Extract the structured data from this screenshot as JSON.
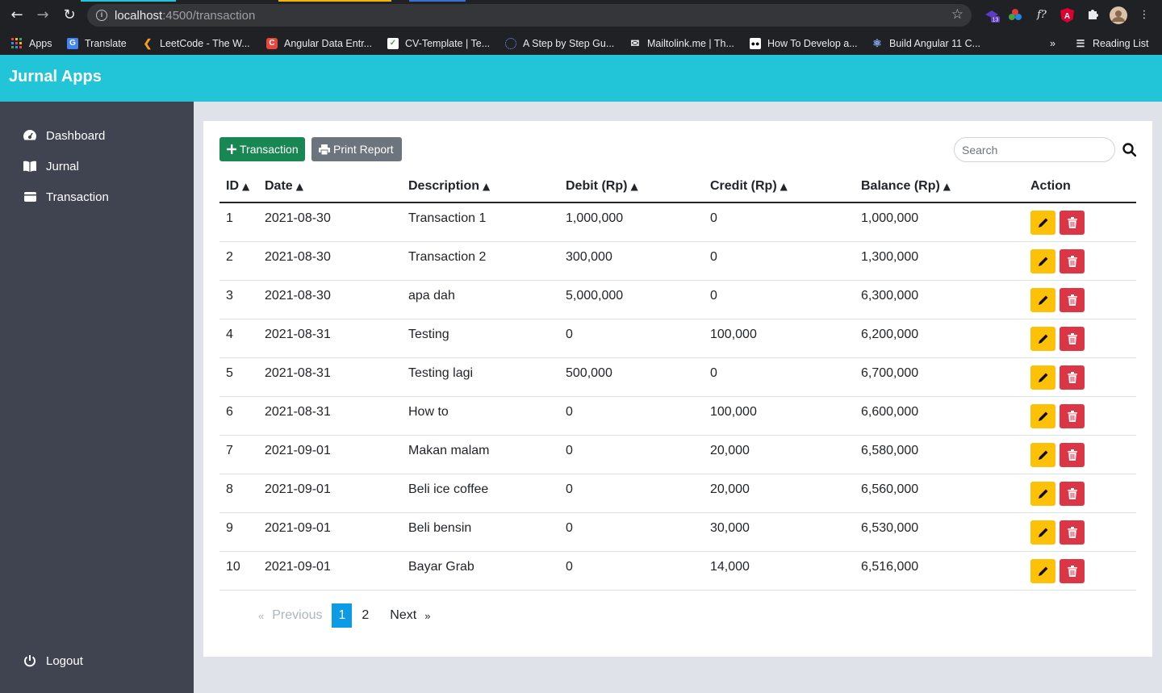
{
  "browser": {
    "url_host": "localhost",
    "url_path": ":4500/transaction",
    "extension_badge": "13",
    "bookmarks": [
      {
        "label": "Apps",
        "icon": "apps-grid-icon",
        "color": "#e8453c"
      },
      {
        "label": "Translate",
        "icon": "google-translate-icon",
        "color": "#4285f4"
      },
      {
        "label": "LeetCode - The W...",
        "icon": "leetcode-icon",
        "color": "#f89f1b"
      },
      {
        "label": "Angular Data Entr...",
        "icon": "codecademy-icon",
        "color": "#e8453c"
      },
      {
        "label": "CV-Template | Te...",
        "icon": "overleaf-icon",
        "color": "#47a141"
      },
      {
        "label": "A Step by Step Gu...",
        "icon": "article-icon",
        "color": "#2a5db0"
      },
      {
        "label": "Mailtolink.me | Th...",
        "icon": "mail-icon",
        "color": "#e8eaed"
      },
      {
        "label": "How To Develop a...",
        "icon": "medium-icon",
        "color": "#ffffff"
      },
      {
        "label": "Build Angular 11 C...",
        "icon": "react-icon",
        "color": "#61dafb"
      }
    ],
    "overflow_label": "»",
    "reading_list_label": "Reading List"
  },
  "app": {
    "title": "Jurnal Apps",
    "header_color": "#22c5d8"
  },
  "sidebar": {
    "items": [
      {
        "label": "Dashboard",
        "icon": "dashboard-gauge-icon"
      },
      {
        "label": "Jurnal",
        "icon": "book-icon"
      },
      {
        "label": "Transaction",
        "icon": "wallet-icon"
      }
    ],
    "logout_label": "Logout"
  },
  "toolbar": {
    "add_label": "Transaction",
    "print_label": "Print Report",
    "search_placeholder": "Search"
  },
  "table": {
    "columns": [
      "ID",
      "Date",
      "Description",
      "Debit (Rp)",
      "Credit (Rp)",
      "Balance (Rp)",
      "Action"
    ],
    "rows": [
      [
        "1",
        "2021-08-30",
        "Transaction 1",
        "1,000,000",
        "0",
        "1,000,000"
      ],
      [
        "2",
        "2021-08-30",
        "Transaction 2",
        "300,000",
        "0",
        "1,300,000"
      ],
      [
        "3",
        "2021-08-30",
        "apa dah",
        "5,000,000",
        "0",
        "6,300,000"
      ],
      [
        "4",
        "2021-08-31",
        "Testing",
        "0",
        "100,000",
        "6,200,000"
      ],
      [
        "5",
        "2021-08-31",
        "Testing lagi",
        "500,000",
        "0",
        "6,700,000"
      ],
      [
        "6",
        "2021-08-31",
        "How to",
        "0",
        "100,000",
        "6,600,000"
      ],
      [
        "7",
        "2021-09-01",
        "Makan malam",
        "0",
        "20,000",
        "6,580,000"
      ],
      [
        "8",
        "2021-09-01",
        "Beli ice coffee",
        "0",
        "20,000",
        "6,560,000"
      ],
      [
        "9",
        "2021-09-01",
        "Beli bensin",
        "0",
        "30,000",
        "6,530,000"
      ],
      [
        "10",
        "2021-09-01",
        "Bayar Grab",
        "0",
        "14,000",
        "6,516,000"
      ]
    ]
  },
  "pagination": {
    "prev_symbol": "«",
    "prev_label": "Previous",
    "pages": [
      "1",
      "2"
    ],
    "active_page": "1",
    "next_label": "Next",
    "next_symbol": "»"
  }
}
